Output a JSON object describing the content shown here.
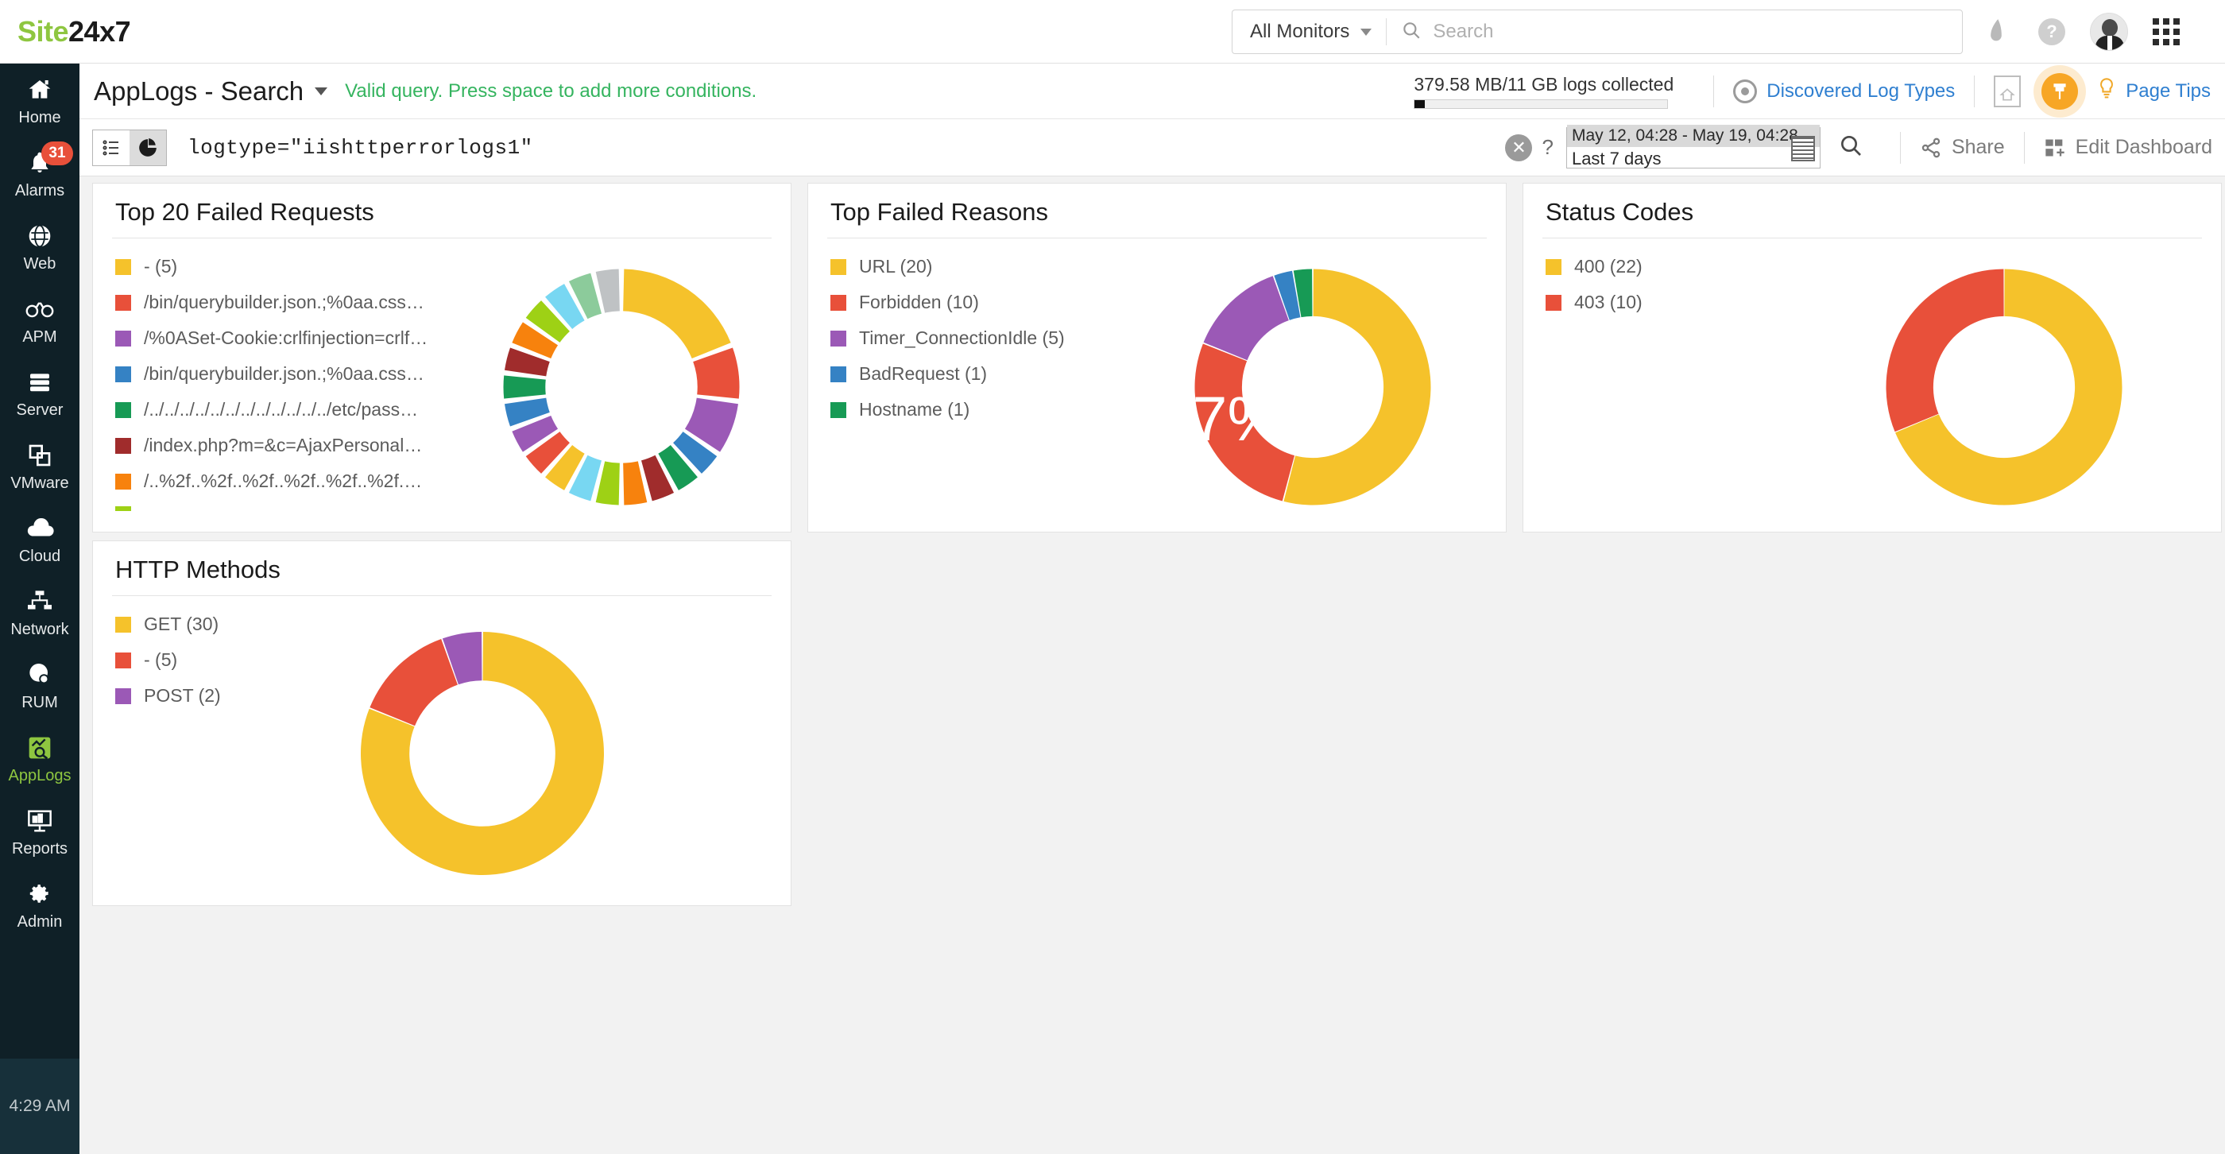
{
  "brand": {
    "name_green": "Site",
    "name_dark": "24x7"
  },
  "topbar": {
    "monitor_filter": "All Monitors",
    "search_placeholder": "Search",
    "search_value": "",
    "icons": [
      "feedback-icon",
      "help-icon",
      "avatar",
      "apps-grid-icon"
    ]
  },
  "sidebar": {
    "items": [
      {
        "label": "Home",
        "icon": "home-icon",
        "badge": "",
        "active": false
      },
      {
        "label": "Alarms",
        "icon": "bell-icon",
        "badge": "31",
        "active": false
      },
      {
        "label": "Web",
        "icon": "globe-icon",
        "badge": "",
        "active": false
      },
      {
        "label": "APM",
        "icon": "binocular-icon",
        "badge": "",
        "active": false
      },
      {
        "label": "Server",
        "icon": "server-icon",
        "badge": "",
        "active": false
      },
      {
        "label": "VMware",
        "icon": "layers-icon",
        "badge": "",
        "active": false
      },
      {
        "label": "Cloud",
        "icon": "cloud-icon",
        "badge": "",
        "active": false
      },
      {
        "label": "Network",
        "icon": "network-icon",
        "badge": "",
        "active": false
      },
      {
        "label": "RUM",
        "icon": "rum-icon",
        "badge": "",
        "active": false
      },
      {
        "label": "AppLogs",
        "icon": "applogs-icon",
        "badge": "",
        "active": true
      },
      {
        "label": "Reports",
        "icon": "reports-icon",
        "badge": "",
        "active": false
      },
      {
        "label": "Admin",
        "icon": "gear-icon",
        "badge": "",
        "active": false
      }
    ],
    "clock": "4:29 AM"
  },
  "page_header": {
    "title": "AppLogs - Search",
    "validation_message": "Valid query. Press space to add more conditions.",
    "logs_collected": "379.58 MB/11 GB logs collected",
    "logs_progress_percent": 4,
    "discovered_log_types": "Discovered Log Types",
    "page_tips": "Page Tips"
  },
  "query_bar": {
    "query": "logtype=\"iishttperrorlogs1\"",
    "help_symbol": "?",
    "clear_symbol": "✕",
    "date_range": "May 12, 04:28 - May 19, 04:28",
    "date_preset": "Last 7 days",
    "share_label": "Share",
    "edit_dashboard_label": "Edit Dashboard"
  },
  "colors": {
    "yellow": "#F5C22B",
    "red": "#E8503A",
    "purple": "#9B59B6",
    "blue": "#3582C4",
    "green": "#179A55",
    "darkred": "#A02C2C",
    "orange": "#F7820D",
    "lime": "#9ED115",
    "skyblue": "#78D7F2",
    "lightgreen": "#8CCB9B",
    "grey": "#BFC2C4",
    "brand_green": "#8ec640",
    "accent_blue": "#2f7fd0",
    "valid_green": "#35b45f",
    "sidebar_bg": "#0f2027"
  },
  "chart_data": [
    {
      "id": "top-20-failed-requests",
      "type": "pie",
      "title": "Top 20 Failed Requests",
      "donut": true,
      "legend_position": "left",
      "legend_truncated": true,
      "categories": [
        "- (5)",
        "/bin/querybuilder.json.;%0aa.css?…",
        "/%0ASet-Cookie:crlfinjection=crlfi…",
        "/bin/querybuilder.json.;%0aa.css?…",
        "/../../../../../../../../../../../../etc/pass…",
        "/index.php?m=&c=AjaxPersonal&…",
        "/..%2f..%2f..%2f..%2f..%2f..%2f.…",
        ""
      ],
      "values": [
        5,
        2,
        2,
        1,
        1,
        1,
        1,
        1,
        1,
        1,
        1,
        1,
        1,
        1,
        1,
        1,
        1,
        1,
        1,
        1
      ],
      "slice_colors": [
        "#F5C22B",
        "#E8503A",
        "#9B59B6",
        "#3582C4",
        "#179A55",
        "#A02C2C",
        "#F7820D",
        "#9ED115",
        "#78D7F2",
        "#F5C22B",
        "#E8503A",
        "#9B59B6",
        "#3582C4",
        "#179A55",
        "#A02C2C",
        "#F7820D",
        "#9ED115",
        "#78D7F2",
        "#8CCB9B",
        "#BFC2C4"
      ],
      "legend_colors": [
        "#F5C22B",
        "#E8503A",
        "#9B59B6",
        "#3582C4",
        "#179A55",
        "#A02C2C",
        "#F7820D",
        "#9ED115"
      ]
    },
    {
      "id": "top-failed-reasons",
      "type": "pie",
      "title": "Top Failed Reasons",
      "donut": true,
      "legend_position": "left",
      "categories": [
        "URL",
        "Forbidden",
        "Timer_ConnectionIdle",
        "BadRequest",
        "Hostname"
      ],
      "legend_labels": [
        "URL (20)",
        "Forbidden (10)",
        "Timer_ConnectionIdle (5)",
        "BadRequest (1)",
        "Hostname (1)"
      ],
      "values": [
        20,
        10,
        5,
        1,
        1
      ],
      "slice_colors": [
        "#F5C22B",
        "#E8503A",
        "#9B59B6",
        "#3582C4",
        "#179A55"
      ],
      "annotations": [
        {
          "text": "27%",
          "slice": "Forbidden"
        }
      ]
    },
    {
      "id": "status-codes",
      "type": "pie",
      "title": "Status Codes",
      "donut": true,
      "legend_position": "left",
      "categories": [
        "400",
        "403"
      ],
      "legend_labels": [
        "400 (22)",
        "403 (10)"
      ],
      "values": [
        22,
        10
      ],
      "slice_colors": [
        "#F5C22B",
        "#E8503A"
      ]
    },
    {
      "id": "http-methods",
      "type": "pie",
      "title": "HTTP Methods",
      "donut": true,
      "legend_position": "left",
      "categories": [
        "GET",
        "-",
        "POST"
      ],
      "legend_labels": [
        "GET (30)",
        "- (5)",
        "POST (2)"
      ],
      "values": [
        30,
        5,
        2
      ],
      "slice_colors": [
        "#F5C22B",
        "#E8503A",
        "#9B59B6"
      ]
    }
  ]
}
